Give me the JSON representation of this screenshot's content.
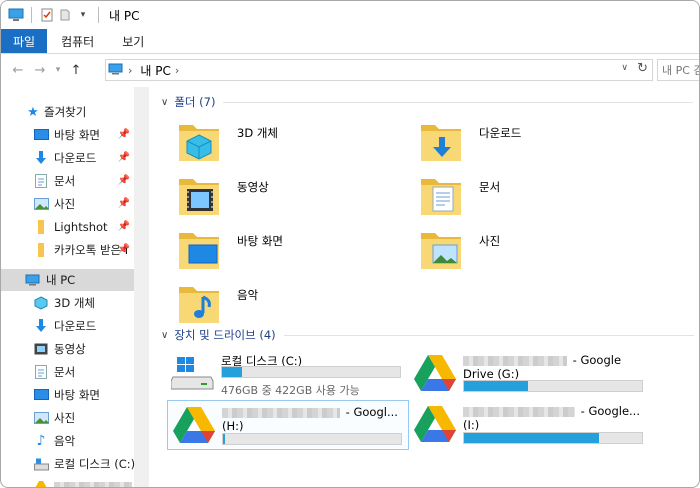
{
  "window": {
    "title": "내 PC"
  },
  "ribbon": {
    "tabs": [
      "파일",
      "컴퓨터",
      "보기"
    ],
    "active_index": 0
  },
  "address": {
    "location": "내 PC",
    "search_placeholder": "내 PC 검"
  },
  "sidebar": {
    "quick_access_label": "즐겨찾기",
    "quick_items": [
      {
        "label": "바탕 화면",
        "icon": "desktop-icon"
      },
      {
        "label": "다운로드",
        "icon": "download-icon"
      },
      {
        "label": "문서",
        "icon": "document-icon"
      },
      {
        "label": "사진",
        "icon": "pictures-icon"
      },
      {
        "label": "Lightshot",
        "icon": "folder-icon"
      },
      {
        "label": "카카오톡 받은 I",
        "icon": "folder-icon"
      }
    ],
    "this_pc_label": "내 PC",
    "pc_items": [
      {
        "label": "3D 개체",
        "icon": "3d-objects-icon"
      },
      {
        "label": "다운로드",
        "icon": "download-icon"
      },
      {
        "label": "동영상",
        "icon": "videos-icon"
      },
      {
        "label": "문서",
        "icon": "document-icon"
      },
      {
        "label": "바탕 화면",
        "icon": "desktop-icon"
      },
      {
        "label": "사진",
        "icon": "pictures-icon"
      },
      {
        "label": "음악",
        "icon": "music-icon"
      },
      {
        "label": "로컬 디스크 (C:)",
        "icon": "local-disk-icon"
      }
    ]
  },
  "folders": {
    "header": "폴더 (7)",
    "items": [
      {
        "label": "3D 개체",
        "icon": "3d-objects-folder-icon"
      },
      {
        "label": "다운로드",
        "icon": "download-folder-icon"
      },
      {
        "label": "동영상",
        "icon": "videos-folder-icon"
      },
      {
        "label": "문서",
        "icon": "documents-folder-icon"
      },
      {
        "label": "바탕 화면",
        "icon": "desktop-folder-icon"
      },
      {
        "label": "사진",
        "icon": "pictures-folder-icon"
      },
      {
        "label": "음악",
        "icon": "music-folder-icon"
      }
    ]
  },
  "drives": {
    "header": "장치 및 드라이브 (4)",
    "items": [
      {
        "name": "로컬 디스크 (C:)",
        "subtitle": "476GB 중 422GB 사용 가능",
        "used_fraction": 0.11,
        "icon": "local-disk-icon"
      },
      {
        "name": "- Google",
        "name2": "Drive (G:)",
        "used_fraction": 0.36,
        "icon": "google-drive-icon"
      },
      {
        "name": "- Googl...",
        "name2": "(H:)",
        "used_fraction": 0.01,
        "icon": "google-drive-icon"
      },
      {
        "name": "- Google...",
        "name2": "(I:)",
        "used_fraction": 0.76,
        "icon": "google-drive-icon"
      }
    ]
  }
}
